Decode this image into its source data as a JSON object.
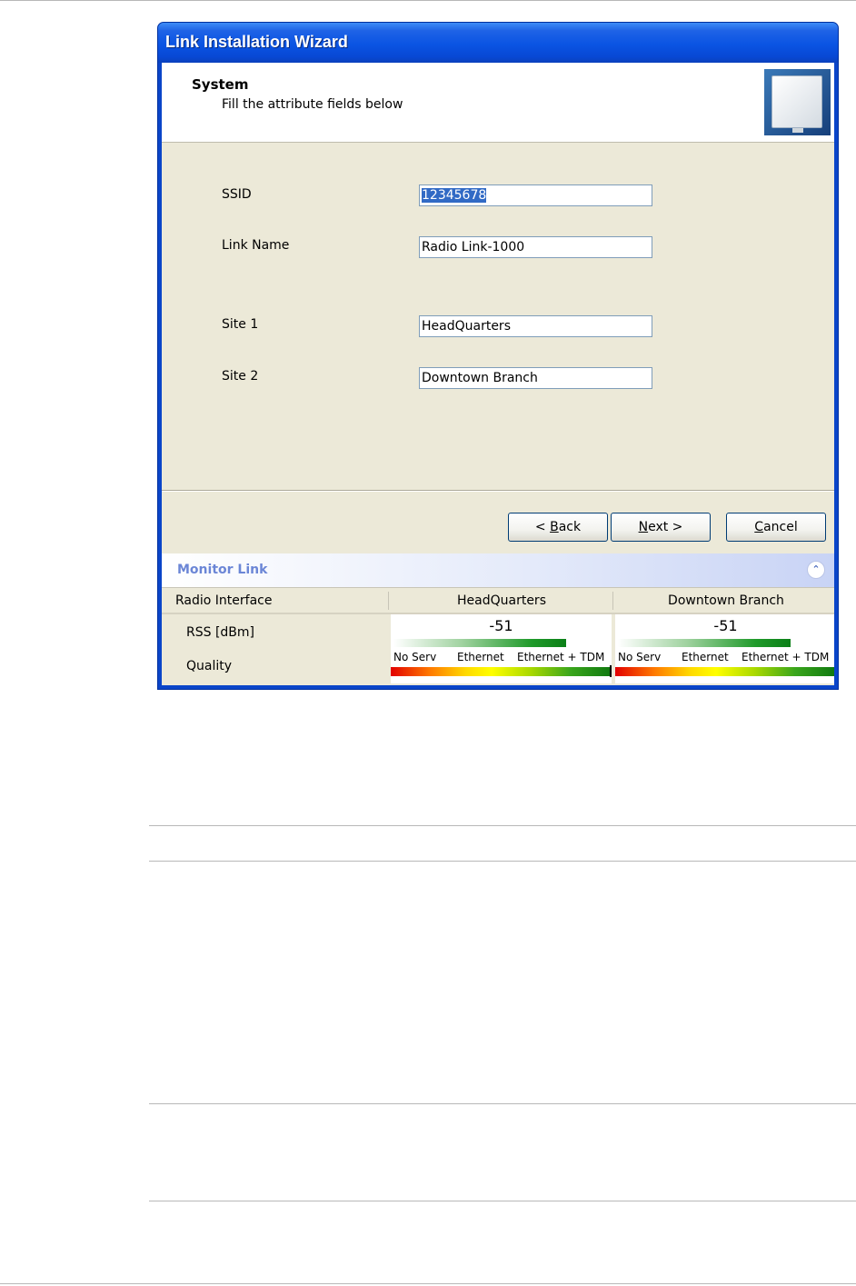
{
  "wizard": {
    "title": "Link Installation Wizard",
    "header_title": "System",
    "header_subtitle": "Fill the attribute fields below",
    "logo_icon": "outdoor-radio-unit-icon"
  },
  "fields": {
    "ssid": {
      "label": "SSID",
      "value": "12345678"
    },
    "link_name": {
      "label": "Link Name",
      "value": "Radio Link-1000"
    },
    "site1": {
      "label": "Site 1",
      "value": "HeadQuarters"
    },
    "site2": {
      "label": "Site 2",
      "value": "Downtown Branch"
    }
  },
  "buttons": {
    "back": {
      "pre": "< ",
      "mnemonic": "B",
      "post": "ack"
    },
    "next": {
      "pre": "",
      "mnemonic": "N",
      "post": "ext >"
    },
    "cancel": {
      "pre": "",
      "mnemonic": "C",
      "post": "ancel"
    }
  },
  "monitor": {
    "title": "Monitor Link",
    "collapse_icon": "double-chevron-up-icon",
    "columns": [
      "Radio Interface",
      "HeadQuarters",
      "Downtown Branch"
    ],
    "rows": {
      "rss": "RSS [dBm]",
      "quality": "Quality"
    },
    "sites": [
      {
        "rss": "-51",
        "rss_level": 0.8,
        "quality_level": 1.0
      },
      {
        "rss": "-51",
        "rss_level": 0.8,
        "quality_level": 1.0
      }
    ],
    "quality_scale": [
      "No Serv",
      "Ethernet",
      "Ethernet + TDM"
    ]
  }
}
